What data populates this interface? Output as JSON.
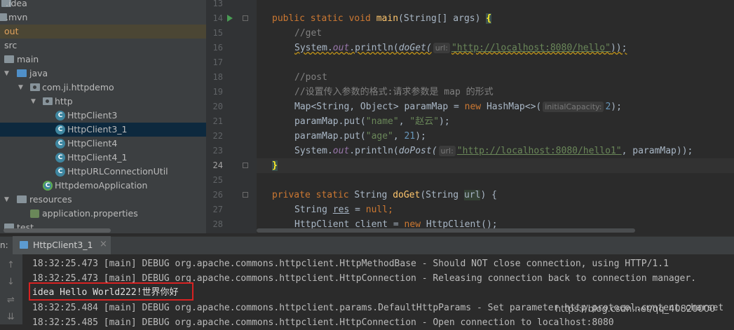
{
  "project_tree": {
    "items": [
      {
        "label": ".idea",
        "type": "folder"
      },
      {
        "label": ".mvn",
        "type": "folder"
      },
      {
        "label": "out",
        "type": "folder-orange"
      },
      {
        "label": "src",
        "type": "folder"
      },
      {
        "label": "main",
        "type": "folder"
      },
      {
        "label": "java",
        "type": "folder-blue"
      },
      {
        "label": "com.ji.httpdemo",
        "type": "package"
      },
      {
        "label": "http",
        "type": "package"
      },
      {
        "label": "HttpClient3",
        "type": "class"
      },
      {
        "label": "HttpClient3_1",
        "type": "class",
        "selected": true
      },
      {
        "label": "HttpClient4",
        "type": "class"
      },
      {
        "label": "HttpClient4_1",
        "type": "class"
      },
      {
        "label": "HttpURLConnectionUtil",
        "type": "class"
      },
      {
        "label": "HttpdemoApplication",
        "type": "spring-class"
      },
      {
        "label": "resources",
        "type": "folder"
      },
      {
        "label": "application.properties",
        "type": "properties"
      },
      {
        "label": "test",
        "type": "folder"
      }
    ]
  },
  "editor": {
    "line_numbers": [
      "13",
      "14",
      "15",
      "16",
      "17",
      "18",
      "19",
      "20",
      "21",
      "22",
      "23",
      "24",
      "25",
      "26",
      "27",
      "28"
    ],
    "current_line": "24",
    "code": {
      "l14_kw": "public static void ",
      "l14_fn": "main",
      "l14_rest": "(String[] args) ",
      "l14_brace": "{",
      "l15": "//get",
      "l16_a": "System.",
      "l16_out": "out",
      "l16_b": ".println(",
      "l16_call": "doGet(",
      "l16_hint": "url:",
      "l16_str": "\"http://localhost:8080/hello\"",
      "l16_c": "));",
      "l18": "//post",
      "l19": "//设置传入参数的格式:请求参数是 map 的形式",
      "l20_a": "Map<String, Object> paramMap = ",
      "l20_new": "new ",
      "l20_b": "HashMap<>(",
      "l20_hint": "initialCapacity:",
      "l20_num": "2",
      "l20_c": ");",
      "l21_a": "paramMap.put(",
      "l21_s1": "\"name\"",
      "l21_b": ", ",
      "l21_s2": "\"赵云\"",
      "l21_c": ");",
      "l22_a": "paramMap.put(",
      "l22_s1": "\"age\"",
      "l22_b": ", ",
      "l22_num": "21",
      "l22_c": ");",
      "l23_a": "System.",
      "l23_out": "out",
      "l23_b": ".println(",
      "l23_call": "doPost(",
      "l23_hint": "url:",
      "l23_str": "\"http://localhost:8080/hello1\"",
      "l23_c": ", paramMap));",
      "l24": "}",
      "l26_kw": "private static ",
      "l26_a": "String ",
      "l26_fn": "doGet",
      "l26_b": "(String ",
      "l26_param": "url",
      "l26_c": ") {",
      "l27_a": "String ",
      "l27_var": "res",
      "l27_b": " = ",
      "l27_null": "null",
      "l27_c": ";",
      "l28_a": "HttpClient client = ",
      "l28_new": "new ",
      "l28_b": "HttpClient();"
    }
  },
  "run_panel": {
    "prefix": "n:",
    "tab_label": "HttpClient3_1",
    "tab_close": "×",
    "console_lines": [
      "18:32:25.473 [main] DEBUG org.apache.commons.httpclient.HttpMethodBase - Should NOT close connection, using HTTP/1.1",
      "18:32:25.473 [main] DEBUG org.apache.commons.httpclient.HttpConnection - Releasing connection back to connection manager.",
      "idea Hello World222!世界你好",
      "18:32:25.484 [main] DEBUG org.apache.commons.httpclient.params.DefaultHttpParams - Set parameter http.protocol.content-charset",
      "18:32:25.485 [main] DEBUG org.apache.commons.httpclient.HttpConnection - Open connection to localhost:8080"
    ],
    "side_buttons": [
      "↑",
      "↓",
      "⇌",
      "⇊"
    ]
  },
  "watermark": "https://blog.csdn.net/qq_40820000"
}
